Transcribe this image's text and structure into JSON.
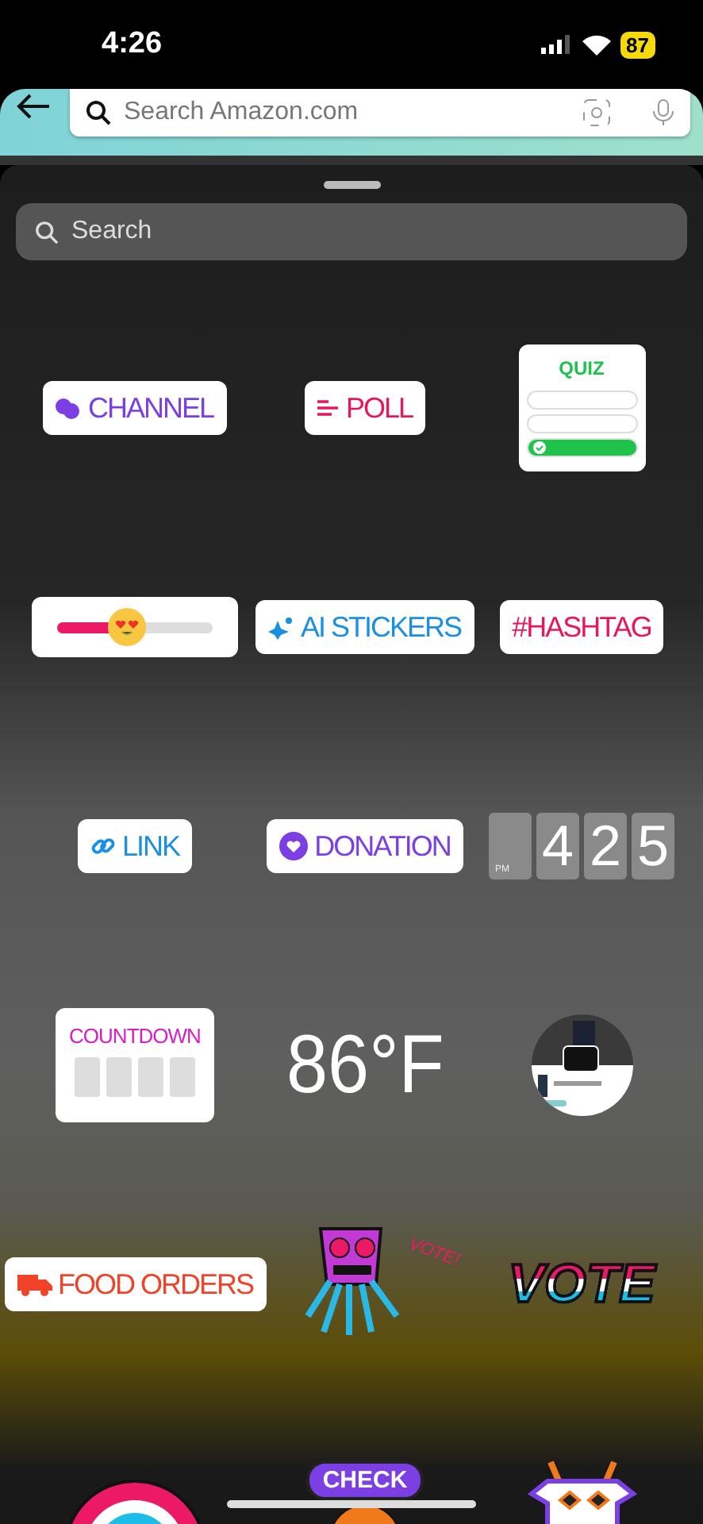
{
  "status_bar": {
    "time": "4:26",
    "battery": "87"
  },
  "browser": {
    "search": {
      "placeholder": "Search Amazon.com"
    }
  },
  "sheet": {
    "search": {
      "placeholder": "Search"
    },
    "stickers": [
      {
        "kind": "channel",
        "label": "CHANNEL",
        "color": "#7b3fe4"
      },
      {
        "kind": "poll",
        "label": "POLL",
        "color": "#e8175d"
      },
      {
        "kind": "quiz",
        "label": "QUIZ",
        "color": "#1fc24a"
      },
      {
        "kind": "slider",
        "level": 0.45
      },
      {
        "kind": "ai",
        "label": "AI STICKERS",
        "color": "#1a8fe3"
      },
      {
        "kind": "hashtag",
        "label": "#HASHTAG",
        "color": "#e8175d"
      },
      {
        "kind": "link",
        "label": "LINK",
        "color": "#1a8fe3"
      },
      {
        "kind": "donation",
        "label": "DONATION",
        "color": "#7b3fe4"
      },
      {
        "kind": "clock",
        "meridiem": "PM",
        "digits": [
          "4",
          "2",
          "5"
        ]
      },
      {
        "kind": "countdown",
        "label": "COUNTDOWN",
        "color": "#d61fc4"
      },
      {
        "kind": "weather",
        "label": "86°F"
      },
      {
        "kind": "product"
      },
      {
        "kind": "food",
        "label": "FOOD ORDERS",
        "color": "#f0432a"
      },
      {
        "kind": "monster",
        "label": "VOTE!"
      },
      {
        "kind": "vote",
        "label": "VOTE"
      },
      {
        "kind": "rainbow"
      },
      {
        "kind": "check",
        "label": "CHECK"
      },
      {
        "kind": "goat"
      }
    ]
  }
}
